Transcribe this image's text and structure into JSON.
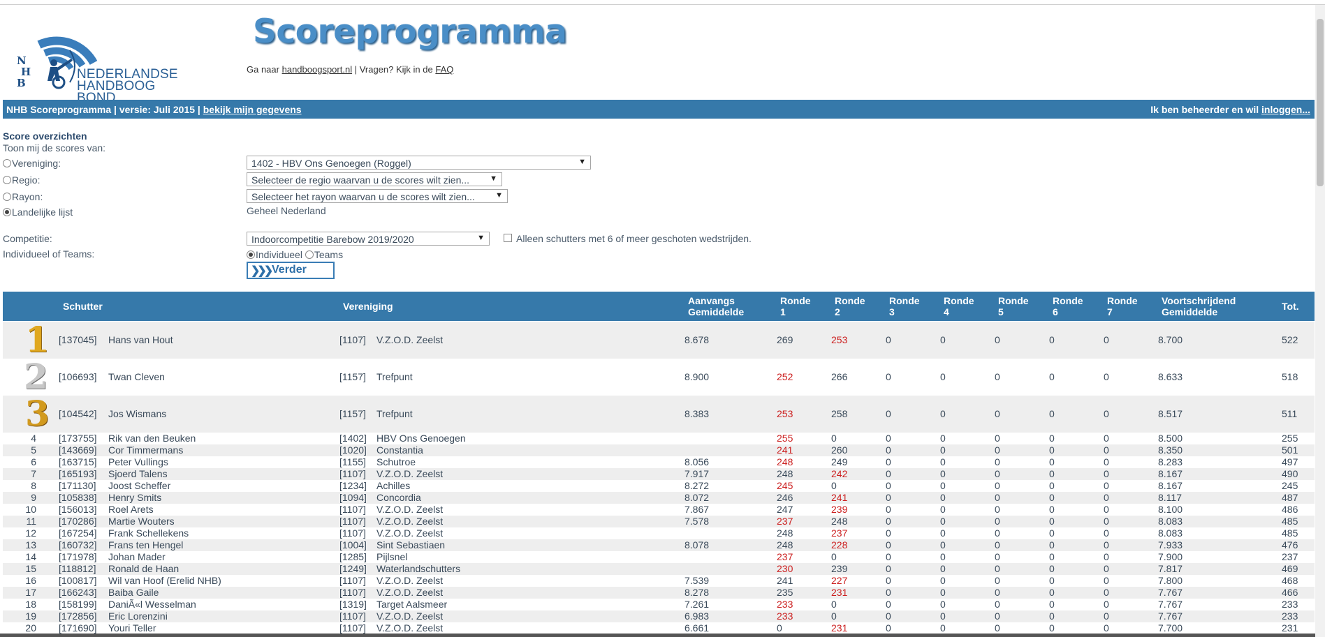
{
  "brand": {
    "logo_text_line1": "NEDERLANDSE",
    "logo_text_line2": "HANDBOOG BOND",
    "logo_letters": [
      "N",
      "H",
      "B"
    ],
    "title": "Scoreprogramma",
    "goto_prefix": "Ga naar",
    "goto_link": "handboogsport.nl",
    "faq_prefix": "| Vragen? Kijk in de",
    "faq_link": "FAQ"
  },
  "navbar": {
    "left_text": "NHB Scoreprogramma | versie: Juli 2015 |",
    "left_link": "bekijk mijn gegevens",
    "right_text": "Ik ben beheerder en wil",
    "right_link": "inloggen..."
  },
  "form": {
    "section_title": "Score overzichten",
    "intro": "Toon mij de scores van:",
    "options": [
      {
        "label": "Vereniging:",
        "selected": false,
        "value": "1402 - HBV Ons Genoegen (Roggel)"
      },
      {
        "label": "Regio:",
        "selected": false,
        "value": "Selecteer de regio waarvan u de scores wilt zien..."
      },
      {
        "label": "Rayon:",
        "selected": false,
        "value": "Selecteer het rayon waarvan u de scores wilt zien..."
      },
      {
        "label": "Landelijke lijst",
        "selected": true,
        "value": "Geheel Nederland"
      }
    ],
    "competition_label": "Competitie:",
    "competition_value": "Indoorcompetitie Barebow 2019/2020",
    "min6_label": "Alleen schutters met 6 of meer geschoten wedstrijden.",
    "type_label": "Individueel of Teams:",
    "type_options": [
      {
        "label": "Individueel",
        "selected": true
      },
      {
        "label": "Teams",
        "selected": false
      }
    ],
    "submit_label": "Verder",
    "submit_chevrons": "❯❯❯"
  },
  "table": {
    "headers": {
      "schutter": "Schutter",
      "vereniging": "Vereniging",
      "aanvang_1": "Aanvangs",
      "aanvang_2": "Gemiddelde",
      "ronde": [
        "Ronde",
        "Ronde",
        "Ronde",
        "Ronde",
        "Ronde",
        "Ronde",
        "Ronde"
      ],
      "ronde_nums": [
        "1",
        "2",
        "3",
        "4",
        "5",
        "6",
        "7"
      ],
      "voort_1": "Voortschrijdend",
      "voort_2": "Gemiddelde",
      "tot": "Tot."
    },
    "rows": [
      {
        "rank": "1",
        "id": "[137045]",
        "name": "Hans van Hout",
        "club_id": "[1107]",
        "club": "V.Z.O.D. Zeelst",
        "avg": "8.678",
        "r": [
          "269",
          "253",
          "0",
          "0",
          "0",
          "0",
          "0"
        ],
        "red": [
          false,
          true,
          false,
          false,
          false,
          false,
          false
        ],
        "prog": "8.700",
        "tot": "522"
      },
      {
        "rank": "2",
        "id": "[106693]",
        "name": "Twan Cleven",
        "club_id": "[1157]",
        "club": "Trefpunt",
        "avg": "8.900",
        "r": [
          "252",
          "266",
          "0",
          "0",
          "0",
          "0",
          "0"
        ],
        "red": [
          true,
          false,
          false,
          false,
          false,
          false,
          false
        ],
        "prog": "8.633",
        "tot": "518"
      },
      {
        "rank": "3",
        "id": "[104542]",
        "name": "Jos Wismans",
        "club_id": "[1157]",
        "club": "Trefpunt",
        "avg": "8.383",
        "r": [
          "253",
          "258",
          "0",
          "0",
          "0",
          "0",
          "0"
        ],
        "red": [
          true,
          false,
          false,
          false,
          false,
          false,
          false
        ],
        "prog": "8.517",
        "tot": "511"
      },
      {
        "rank": "4",
        "id": "[173755]",
        "name": "Rik van den Beuken",
        "club_id": "[1402]",
        "club": "HBV Ons Genoegen",
        "avg": "",
        "r": [
          "255",
          "0",
          "0",
          "0",
          "0",
          "0",
          "0"
        ],
        "red": [
          true,
          false,
          false,
          false,
          false,
          false,
          false
        ],
        "prog": "8.500",
        "tot": "255"
      },
      {
        "rank": "5",
        "id": "[143669]",
        "name": "Cor Timmermans",
        "club_id": "[1020]",
        "club": "Constantia",
        "avg": "",
        "r": [
          "241",
          "260",
          "0",
          "0",
          "0",
          "0",
          "0"
        ],
        "red": [
          true,
          false,
          false,
          false,
          false,
          false,
          false
        ],
        "prog": "8.350",
        "tot": "501"
      },
      {
        "rank": "6",
        "id": "[163715]",
        "name": "Peter Vullings",
        "club_id": "[1155]",
        "club": "Schutroe",
        "avg": "8.056",
        "r": [
          "248",
          "249",
          "0",
          "0",
          "0",
          "0",
          "0"
        ],
        "red": [
          true,
          false,
          false,
          false,
          false,
          false,
          false
        ],
        "prog": "8.283",
        "tot": "497"
      },
      {
        "rank": "7",
        "id": "[165193]",
        "name": "Sjoerd Talens",
        "club_id": "[1107]",
        "club": "V.Z.O.D. Zeelst",
        "avg": "7.917",
        "r": [
          "248",
          "242",
          "0",
          "0",
          "0",
          "0",
          "0"
        ],
        "red": [
          false,
          true,
          false,
          false,
          false,
          false,
          false
        ],
        "prog": "8.167",
        "tot": "490"
      },
      {
        "rank": "8",
        "id": "[171130]",
        "name": "Joost Scheffer",
        "club_id": "[1234]",
        "club": "Achilles",
        "avg": "8.272",
        "r": [
          "245",
          "0",
          "0",
          "0",
          "0",
          "0",
          "0"
        ],
        "red": [
          true,
          false,
          false,
          false,
          false,
          false,
          false
        ],
        "prog": "8.167",
        "tot": "245"
      },
      {
        "rank": "9",
        "id": "[105838]",
        "name": "Henry Smits",
        "club_id": "[1094]",
        "club": "Concordia",
        "avg": "8.072",
        "r": [
          "246",
          "241",
          "0",
          "0",
          "0",
          "0",
          "0"
        ],
        "red": [
          false,
          true,
          false,
          false,
          false,
          false,
          false
        ],
        "prog": "8.117",
        "tot": "487"
      },
      {
        "rank": "10",
        "id": "[156013]",
        "name": "Roel Arets",
        "club_id": "[1107]",
        "club": "V.Z.O.D. Zeelst",
        "avg": "7.867",
        "r": [
          "247",
          "239",
          "0",
          "0",
          "0",
          "0",
          "0"
        ],
        "red": [
          false,
          true,
          false,
          false,
          false,
          false,
          false
        ],
        "prog": "8.100",
        "tot": "486"
      },
      {
        "rank": "11",
        "id": "[170286]",
        "name": "Martie Wouters",
        "club_id": "[1107]",
        "club": "V.Z.O.D. Zeelst",
        "avg": "7.578",
        "r": [
          "237",
          "248",
          "0",
          "0",
          "0",
          "0",
          "0"
        ],
        "red": [
          true,
          false,
          false,
          false,
          false,
          false,
          false
        ],
        "prog": "8.083",
        "tot": "485"
      },
      {
        "rank": "12",
        "id": "[167254]",
        "name": "Frank Schellekens",
        "club_id": "[1107]",
        "club": "V.Z.O.D. Zeelst",
        "avg": "",
        "r": [
          "248",
          "237",
          "0",
          "0",
          "0",
          "0",
          "0"
        ],
        "red": [
          false,
          true,
          false,
          false,
          false,
          false,
          false
        ],
        "prog": "8.083",
        "tot": "485"
      },
      {
        "rank": "13",
        "id": "[160732]",
        "name": "Frans ten Hengel",
        "club_id": "[1004]",
        "club": "Sint Sebastiaen",
        "avg": "8.078",
        "r": [
          "248",
          "228",
          "0",
          "0",
          "0",
          "0",
          "0"
        ],
        "red": [
          false,
          true,
          false,
          false,
          false,
          false,
          false
        ],
        "prog": "7.933",
        "tot": "476"
      },
      {
        "rank": "14",
        "id": "[171978]",
        "name": "Johan Mader",
        "club_id": "[1285]",
        "club": "Pijlsnel",
        "avg": "",
        "r": [
          "237",
          "0",
          "0",
          "0",
          "0",
          "0",
          "0"
        ],
        "red": [
          true,
          false,
          false,
          false,
          false,
          false,
          false
        ],
        "prog": "7.900",
        "tot": "237"
      },
      {
        "rank": "15",
        "id": "[118812]",
        "name": "Ronald de Haan",
        "club_id": "[1249]",
        "club": "Waterlandschutters",
        "avg": "",
        "r": [
          "230",
          "239",
          "0",
          "0",
          "0",
          "0",
          "0"
        ],
        "red": [
          true,
          false,
          false,
          false,
          false,
          false,
          false
        ],
        "prog": "7.817",
        "tot": "469"
      },
      {
        "rank": "16",
        "id": "[100817]",
        "name": "Wil van Hoof (Erelid NHB)",
        "club_id": "[1107]",
        "club": "V.Z.O.D. Zeelst",
        "avg": "7.539",
        "r": [
          "241",
          "227",
          "0",
          "0",
          "0",
          "0",
          "0"
        ],
        "red": [
          false,
          true,
          false,
          false,
          false,
          false,
          false
        ],
        "prog": "7.800",
        "tot": "468"
      },
      {
        "rank": "17",
        "id": "[166243]",
        "name": "Baiba Gaile",
        "club_id": "[1107]",
        "club": "V.Z.O.D. Zeelst",
        "avg": "8.278",
        "r": [
          "235",
          "231",
          "0",
          "0",
          "0",
          "0",
          "0"
        ],
        "red": [
          false,
          true,
          false,
          false,
          false,
          false,
          false
        ],
        "prog": "7.767",
        "tot": "466"
      },
      {
        "rank": "18",
        "id": "[158199]",
        "name": "DaniÃ«l Wesselman",
        "club_id": "[1319]",
        "club": "Target Aalsmeer",
        "avg": "7.261",
        "r": [
          "233",
          "0",
          "0",
          "0",
          "0",
          "0",
          "0"
        ],
        "red": [
          true,
          false,
          false,
          false,
          false,
          false,
          false
        ],
        "prog": "7.767",
        "tot": "233"
      },
      {
        "rank": "19",
        "id": "[172856]",
        "name": "Eric Lorenzini",
        "club_id": "[1107]",
        "club": "V.Z.O.D. Zeelst",
        "avg": "6.983",
        "r": [
          "233",
          "0",
          "0",
          "0",
          "0",
          "0",
          "0"
        ],
        "red": [
          true,
          false,
          false,
          false,
          false,
          false,
          false
        ],
        "prog": "7.767",
        "tot": "233"
      },
      {
        "rank": "20",
        "id": "[171690]",
        "name": "Youri Teller",
        "club_id": "[1107]",
        "club": "V.Z.O.D. Zeelst",
        "avg": "6.661",
        "r": [
          "0",
          "231",
          "0",
          "0",
          "0",
          "0",
          "0"
        ],
        "red": [
          false,
          true,
          false,
          false,
          false,
          false,
          false
        ],
        "prog": "7.700",
        "tot": "231"
      }
    ]
  },
  "colors": {
    "header_blue": "#3679aa",
    "title_blue": "#4a8ec7",
    "row_alt": "#eeeeee",
    "score_red": "#cc2020",
    "gold": "#e0a820",
    "silver": "#c8c8c8",
    "bronze": "#d29a1e"
  }
}
